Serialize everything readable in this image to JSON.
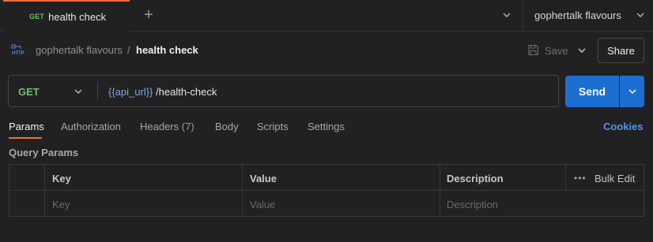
{
  "tab": {
    "method": "GET",
    "name": "health check"
  },
  "environment": {
    "selected": "gophertalk flavours"
  },
  "breadcrumb": {
    "collection": "gophertalk flavours",
    "separator": "/",
    "request": "health check"
  },
  "toolbar": {
    "save_label": "Save",
    "share_label": "Share"
  },
  "request": {
    "method": "GET",
    "url_variable": "{{api_url}}",
    "url_path": "/health-check",
    "send_label": "Send"
  },
  "request_tabs": {
    "params": "Params",
    "authorization": "Authorization",
    "headers": "Headers",
    "headers_count": "(7)",
    "body": "Body",
    "scripts": "Scripts",
    "settings": "Settings",
    "cookies": "Cookies"
  },
  "query_params": {
    "title": "Query Params",
    "columns": {
      "key": "Key",
      "value": "Value",
      "description": "Description",
      "bulk_edit": "Bulk Edit"
    },
    "placeholder_row": {
      "key": "Key",
      "value": "Value",
      "description": "Description"
    }
  },
  "colors": {
    "accent": "#f26b3a",
    "method_get": "#6bc06e",
    "send": "#1c6fd1",
    "link": "#4e96ee",
    "variable": "#7aa5e8"
  }
}
